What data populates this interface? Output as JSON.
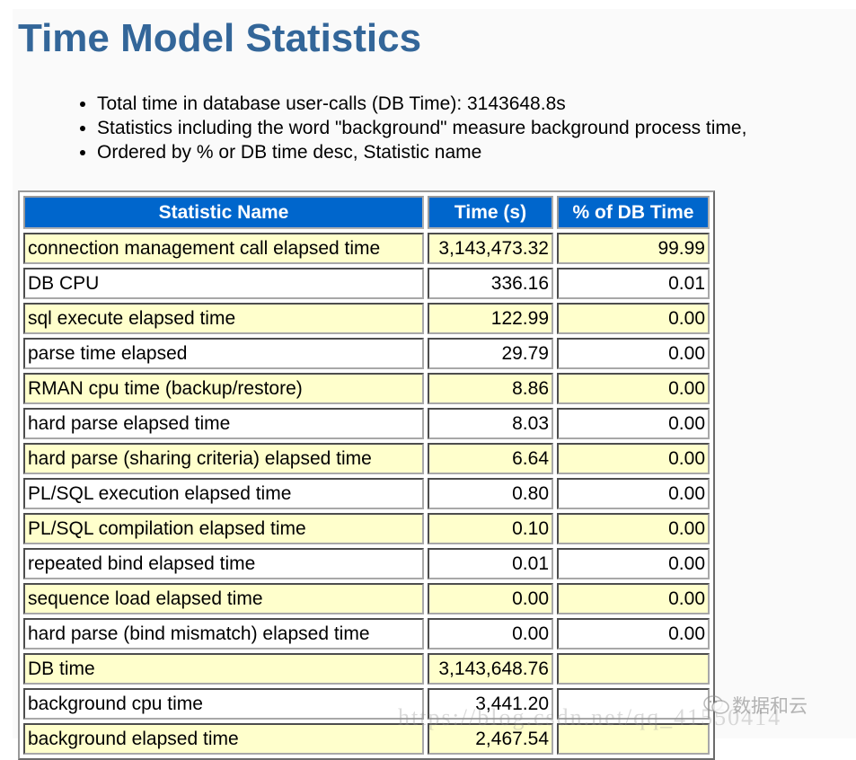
{
  "page": {
    "title": "Time Model Statistics",
    "notes": [
      "Total time in database user-calls (DB Time): 3143648.8s",
      "Statistics including the word \"background\" measure background process time,",
      "Ordered by % or DB time desc, Statistic name"
    ]
  },
  "table": {
    "columns": [
      "Statistic Name",
      "Time (s)",
      "% of DB Time"
    ],
    "header_color": "#0066cc",
    "odd_row_color": "#ffffcc",
    "rows": [
      {
        "name": "connection management call elapsed time",
        "time": "3,143,473.32",
        "pct": "99.99"
      },
      {
        "name": "DB CPU",
        "time": "336.16",
        "pct": "0.01"
      },
      {
        "name": "sql execute elapsed time",
        "time": "122.99",
        "pct": "0.00"
      },
      {
        "name": "parse time elapsed",
        "time": "29.79",
        "pct": "0.00"
      },
      {
        "name": "RMAN cpu time (backup/restore)",
        "time": "8.86",
        "pct": "0.00"
      },
      {
        "name": "hard parse elapsed time",
        "time": "8.03",
        "pct": "0.00"
      },
      {
        "name": "hard parse (sharing criteria) elapsed time",
        "time": "6.64",
        "pct": "0.00"
      },
      {
        "name": "PL/SQL execution elapsed time",
        "time": "0.80",
        "pct": "0.00"
      },
      {
        "name": "PL/SQL compilation elapsed time",
        "time": "0.10",
        "pct": "0.00"
      },
      {
        "name": "repeated bind elapsed time",
        "time": "0.01",
        "pct": "0.00"
      },
      {
        "name": "sequence load elapsed time",
        "time": "0.00",
        "pct": "0.00"
      },
      {
        "name": "hard parse (bind mismatch) elapsed time",
        "time": "0.00",
        "pct": "0.00"
      },
      {
        "name": "DB time",
        "time": "3,143,648.76",
        "pct": ""
      },
      {
        "name": "background cpu time",
        "time": "3,441.20",
        "pct": ""
      },
      {
        "name": "background elapsed time",
        "time": "2,467.54",
        "pct": ""
      }
    ]
  },
  "watermarks": {
    "url": "https://blog.csdn.net/qq_41550414",
    "brand": "数据和云",
    "brand_icon": "wechat-icon"
  }
}
